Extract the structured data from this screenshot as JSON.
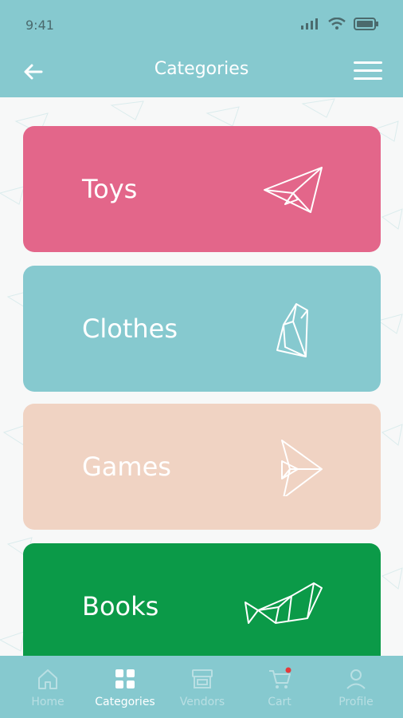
{
  "status": {
    "time": "9:41"
  },
  "header": {
    "title": "Categories"
  },
  "categories": [
    {
      "label": "Toys",
      "color": "#e3668a",
      "icon": "paper-plane-icon"
    },
    {
      "label": "Clothes",
      "color": "#86c9cf",
      "icon": "origami-penguin-icon"
    },
    {
      "label": "Games",
      "color": "#f0d3c3",
      "icon": "origami-fish-icon"
    },
    {
      "label": "Books",
      "color": "#0b9a48",
      "icon": "origami-whale-icon"
    }
  ],
  "bottom_nav": {
    "active": "Categories",
    "items": [
      {
        "label": "Home",
        "icon": "home-icon"
      },
      {
        "label": "Categories",
        "icon": "grid-icon"
      },
      {
        "label": "Vendors",
        "icon": "store-icon"
      },
      {
        "label": "Cart",
        "icon": "cart-icon"
      },
      {
        "label": "Profile",
        "icon": "profile-icon"
      }
    ]
  },
  "colors": {
    "header": "#86c9cf",
    "active_tab": "#ffffff",
    "inactive_tab": "#b9dfe3",
    "cart_badge": "#e53b3b"
  }
}
